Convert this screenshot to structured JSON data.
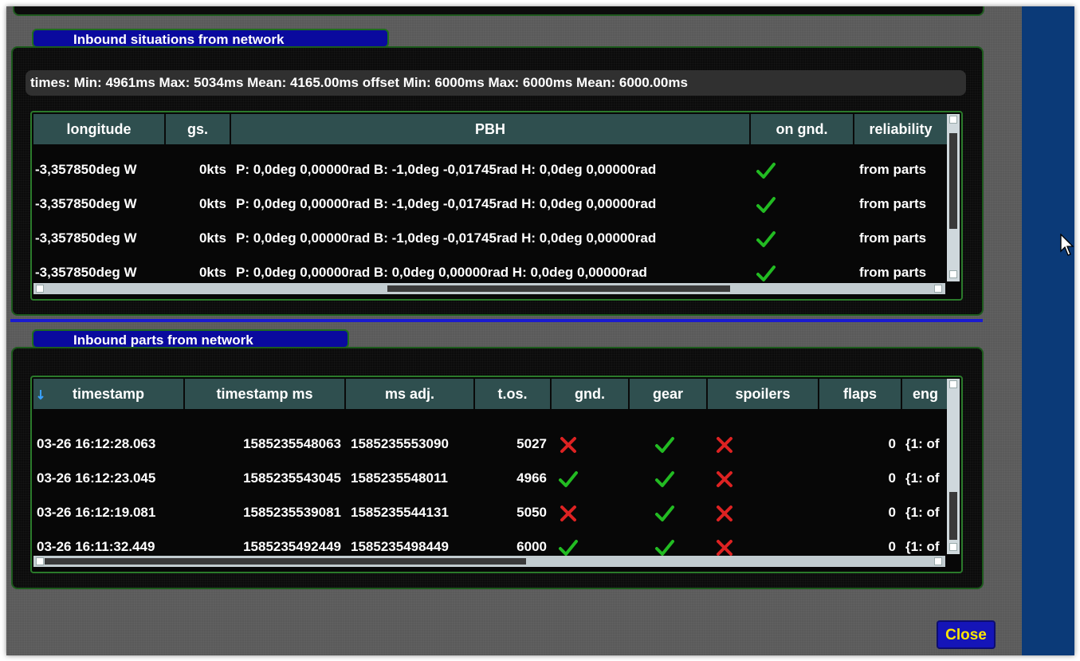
{
  "situations": {
    "title": "Inbound situations from network",
    "times_text": "times: Min: 4961ms Max: 5034ms Mean: 4165.00ms offset Min: 6000ms Max: 6000ms Mean: 6000.00ms",
    "columns": [
      "longitude",
      "gs.",
      "PBH",
      "on gnd.",
      "reliability"
    ],
    "rows": [
      {
        "longitude": "-3,357850deg W",
        "gs": "0kts",
        "pbh": "P: 0,0deg 0,00000rad B: -1,0deg -0,01745rad H: 0,0deg 0,00000rad",
        "on_gnd": "check",
        "reliability": "from parts"
      },
      {
        "longitude": "-3,357850deg W",
        "gs": "0kts",
        "pbh": "P: 0,0deg 0,00000rad B: -1,0deg -0,01745rad H: 0,0deg 0,00000rad",
        "on_gnd": "check",
        "reliability": "from parts"
      },
      {
        "longitude": "-3,357850deg W",
        "gs": "0kts",
        "pbh": "P: 0,0deg 0,00000rad B: -1,0deg -0,01745rad H: 0,0deg 0,00000rad",
        "on_gnd": "check",
        "reliability": "from parts"
      },
      {
        "longitude": "-3,357850deg W",
        "gs": "0kts",
        "pbh": "P: 0,0deg 0,00000rad B: 0,0deg 0,00000rad H: 0,0deg 0,00000rad",
        "on_gnd": "check",
        "reliability": "from parts"
      }
    ]
  },
  "parts": {
    "title": "Inbound parts from network",
    "columns": [
      "timestamp",
      "timestamp ms",
      "ms adj.",
      "t.os.",
      "gnd.",
      "gear",
      "spoilers",
      "flaps",
      "eng"
    ],
    "rows": [
      {
        "timestamp": "03-26 16:12:28.063",
        "timestamp_ms": "1585235548063",
        "ms_adj": "1585235553090",
        "tos": "5027",
        "gnd": "cross",
        "gear": "check",
        "spoilers": "cross",
        "flaps": "0",
        "eng": "{1: of"
      },
      {
        "timestamp": "03-26 16:12:23.045",
        "timestamp_ms": "1585235543045",
        "ms_adj": "1585235548011",
        "tos": "4966",
        "gnd": "check",
        "gear": "check",
        "spoilers": "cross",
        "flaps": "0",
        "eng": "{1: of"
      },
      {
        "timestamp": "03-26 16:12:19.081",
        "timestamp_ms": "1585235539081",
        "ms_adj": "1585235544131",
        "tos": "5050",
        "gnd": "cross",
        "gear": "check",
        "spoilers": "cross",
        "flaps": "0",
        "eng": "{1: of"
      },
      {
        "timestamp": "03-26 16:11:32.449",
        "timestamp_ms": "1585235492449",
        "ms_adj": "1585235498449",
        "tos": "6000",
        "gnd": "check",
        "gear": "check",
        "spoilers": "cross",
        "flaps": "0",
        "eng": "{1: of"
      }
    ]
  },
  "close_label": "Close",
  "colors": {
    "check": "#22bb22",
    "cross": "#dd2222",
    "tab_bg": "#0a0a9e",
    "header_bg": "#2f4f4f",
    "close_text": "#ffe600"
  },
  "icons": [
    "check-icon",
    "cross-icon",
    "sort-down-icon",
    "mouse-cursor-icon"
  ]
}
